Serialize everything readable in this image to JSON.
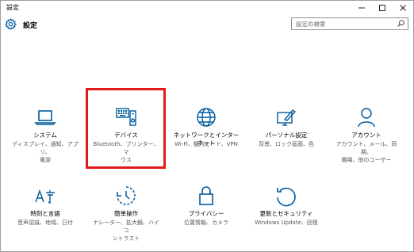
{
  "window": {
    "title": "設定",
    "controls": [
      "minimize-icon",
      "maximize-icon",
      "close-icon"
    ]
  },
  "header": {
    "title": "設定",
    "icon": "gear-icon"
  },
  "search": {
    "placeholder": "設定の検索",
    "icon": "search-icon"
  },
  "accent_color": "#005a9e",
  "highlight_color": "#e01a1a",
  "tiles": [
    {
      "label": "システム",
      "desc_lines": [
        "ディスプレイ、通知、アプリ、",
        "電源"
      ],
      "icon": "laptop-icon"
    },
    {
      "label": "デバイス",
      "desc_lines": [
        "Bluetooth、プリンター、マ",
        "ウス"
      ],
      "icon": "keyboard-device-icon",
      "highlighted": true
    },
    {
      "label": "ネットワークとインターネット",
      "desc_lines": [
        "Wi-Fi、機内モード、VPN"
      ],
      "icon": "globe-icon"
    },
    {
      "label": "パーソナル設定",
      "desc_lines": [
        "背景、ロック画面、色"
      ],
      "icon": "paint-screen-icon"
    },
    {
      "label": "アカウント",
      "desc_lines": [
        "アカウント、メール、同期、",
        "職場、他のユーザー"
      ],
      "icon": "person-icon"
    },
    {
      "label": "時刻と言語",
      "desc_lines": [
        "音声認識、地域、日付"
      ],
      "icon": "language-clock-icon"
    },
    {
      "label": "簡単操作",
      "desc_lines": [
        "ナレーター、拡大鏡、ハイコ",
        "ントラスト"
      ],
      "icon": "ease-of-access-icon"
    },
    {
      "label": "プライバシー",
      "desc_lines": [
        "位置情報、カメラ"
      ],
      "icon": "lock-icon"
    },
    {
      "label": "更新とセキュリティ",
      "desc_lines": [
        "Windows Update、回復"
      ],
      "icon": "update-icon"
    }
  ]
}
